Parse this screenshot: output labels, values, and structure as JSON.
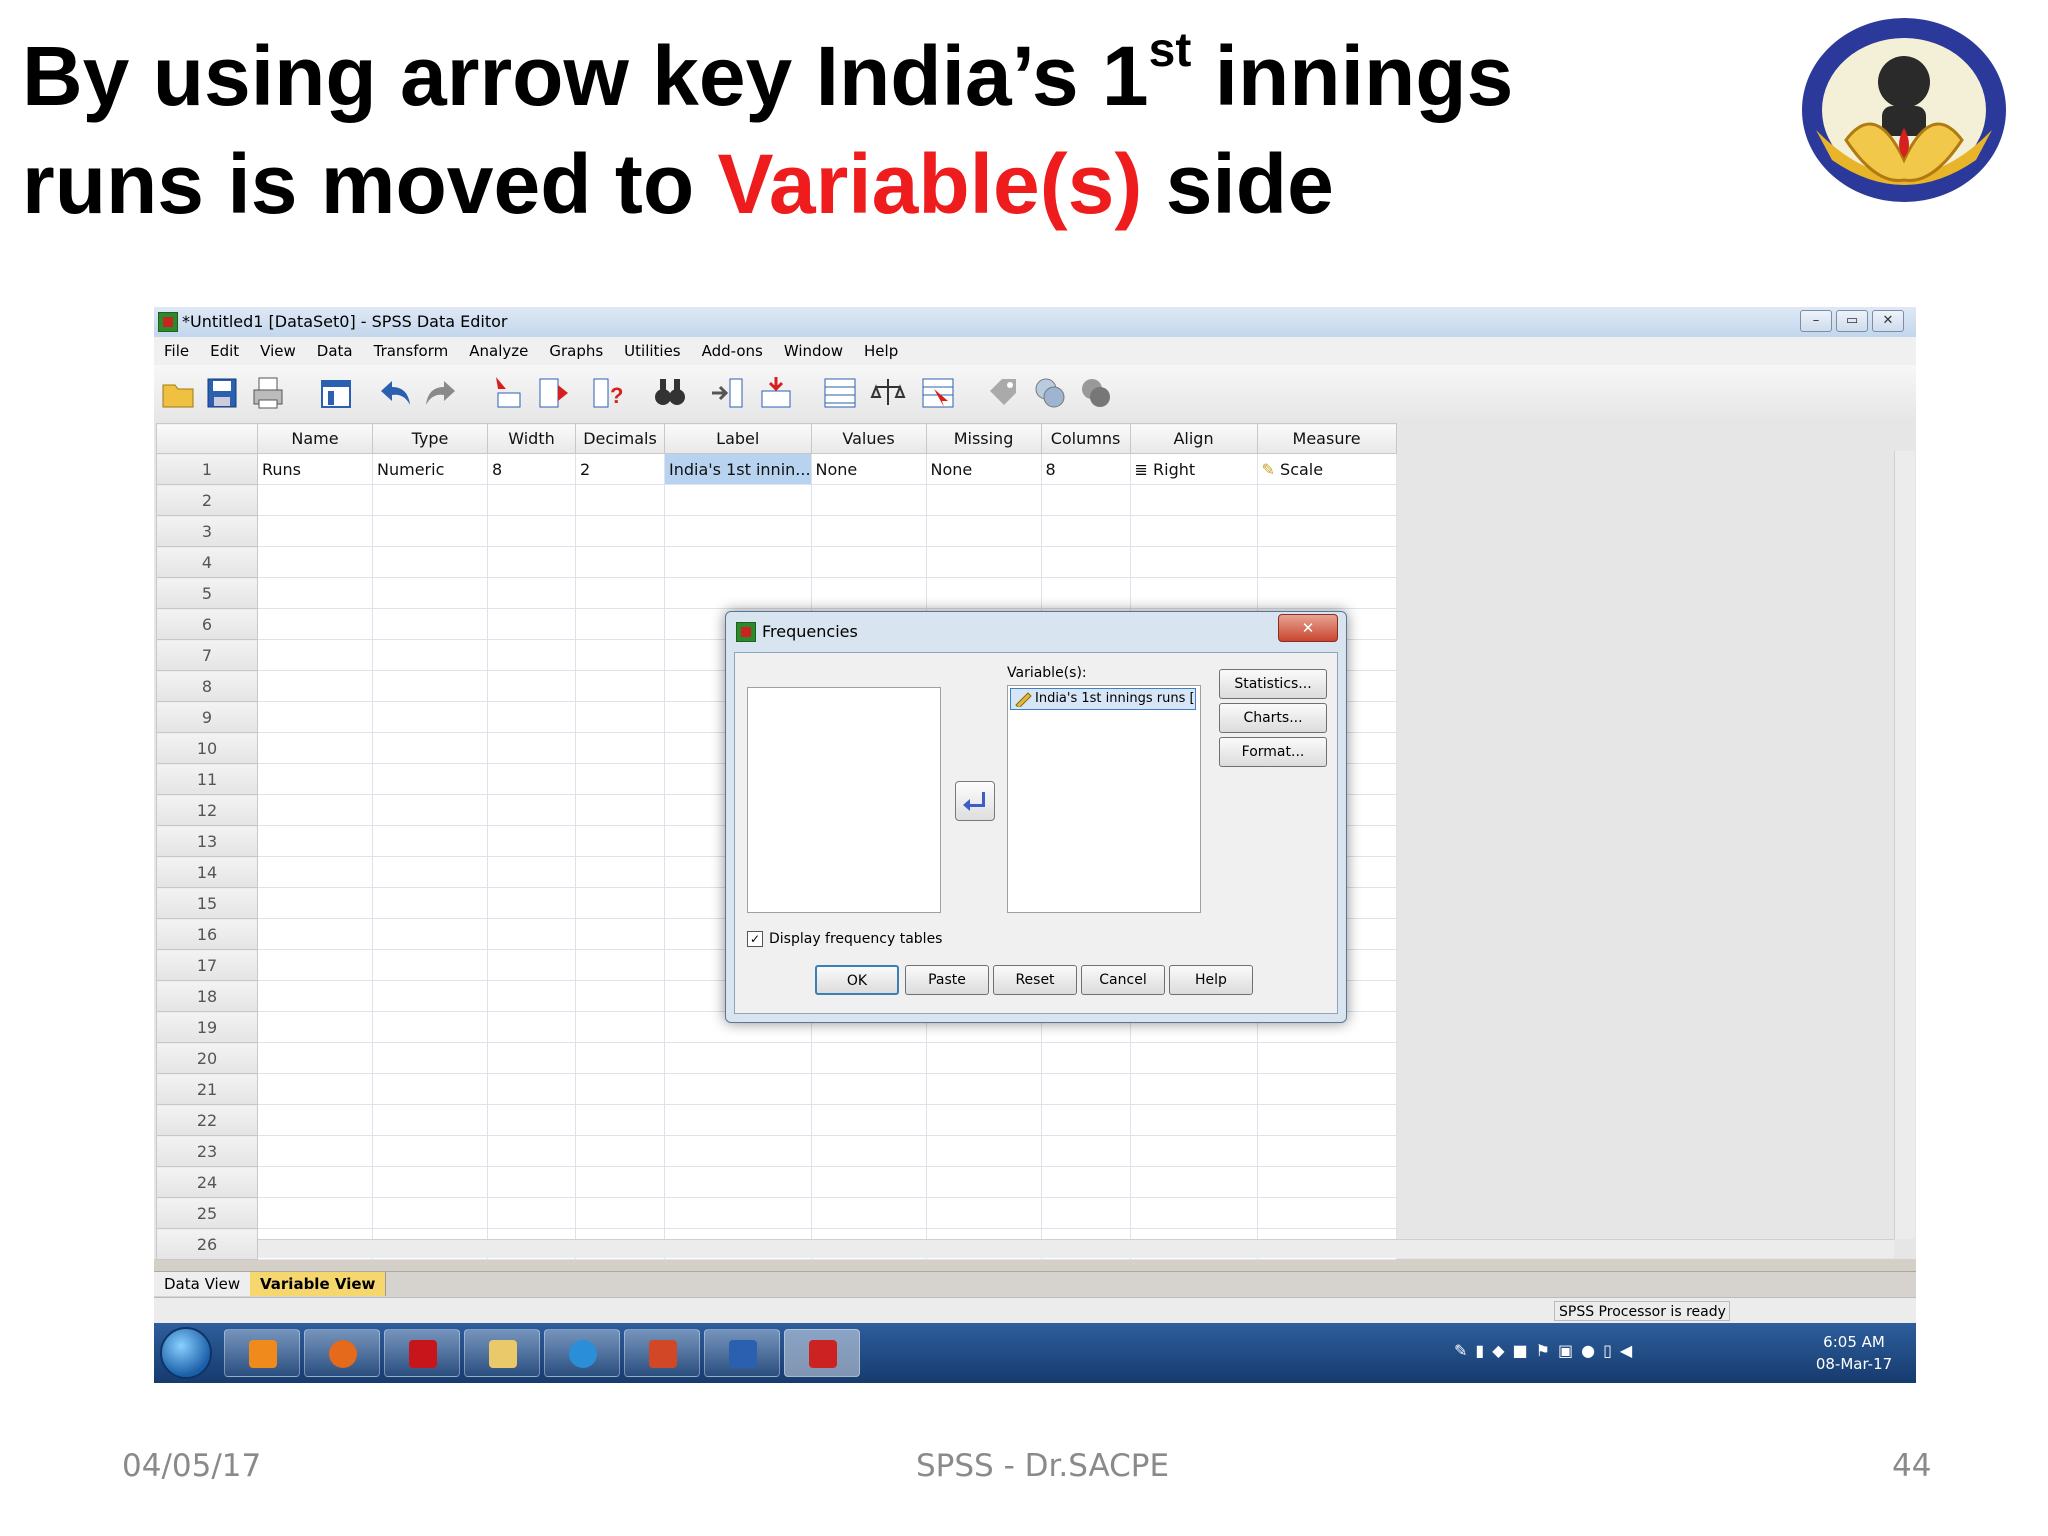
{
  "slide": {
    "title_part1": "By using arrow key India’s 1",
    "title_sup": "st",
    "title_part2": " innings",
    "title_part3": "runs is moved to ",
    "title_red": "Variable(s)",
    "title_part4": " side",
    "footer_date": "04/05/17",
    "footer_center": "SPSS - Dr.SACPE",
    "footer_page": "44",
    "accent_red": "#ee1c1c"
  },
  "window": {
    "title": "*Untitled1 [DataSet0] - SPSS Data Editor",
    "controls": [
      "–",
      "▭",
      "✕"
    ]
  },
  "menu": [
    "File",
    "Edit",
    "View",
    "Data",
    "Transform",
    "Analyze",
    "Graphs",
    "Utilities",
    "Add-ons",
    "Window",
    "Help"
  ],
  "toolbar_icons": [
    "open-icon",
    "save-icon",
    "print-icon",
    "dialog-recall-icon",
    "undo-icon",
    "redo-icon",
    "goto-case-icon",
    "goto-variable-icon",
    "variables-icon",
    "find-icon",
    "insert-variable-icon",
    "insert-case-icon",
    "split-file-icon",
    "weight-cases-icon",
    "select-cases-icon",
    "value-labels-icon",
    "use-sets-icon",
    "show-all-icon"
  ],
  "grid": {
    "headers": [
      "Name",
      "Type",
      "Width",
      "Decimals",
      "Label",
      "Values",
      "Missing",
      "Columns",
      "Align",
      "Measure"
    ],
    "row1": {
      "num": "1",
      "cells": [
        "Runs",
        "Numeric",
        "8",
        "2",
        "India's 1st innin...",
        "None",
        "None",
        "8",
        "Right",
        "Scale"
      ]
    },
    "row_numbers": [
      "2",
      "3",
      "4",
      "5",
      "6",
      "7",
      "8",
      "9",
      "10",
      "11",
      "12",
      "13",
      "14",
      "15",
      "16",
      "17",
      "18",
      "19",
      "20",
      "21",
      "22",
      "23",
      "24",
      "25",
      "26"
    ]
  },
  "tabs": [
    "Data View",
    "Variable View"
  ],
  "status": "SPSS  Processor is ready",
  "clock": {
    "time": "6:05 AM",
    "date": "08-Mar-17"
  },
  "taskbar_apps": [
    "media-player-icon",
    "firefox-icon",
    "acrobat-icon",
    "file-explorer-icon",
    "internet-explorer-icon",
    "powerpoint-icon",
    "word-icon",
    "spss-icon"
  ],
  "dialog": {
    "title": "Frequencies",
    "close": "✕",
    "variables_label": "Variable(s):",
    "variable_item": "India's 1st innings runs [...",
    "side_buttons": [
      "Statistics...",
      "Charts...",
      "Format..."
    ],
    "checkbox_label": "Display frequency tables",
    "checkbox_checked": true,
    "checkbox_mark": "✓",
    "bottom_buttons": [
      "OK",
      "Paste",
      "Reset",
      "Cancel",
      "Help"
    ]
  }
}
